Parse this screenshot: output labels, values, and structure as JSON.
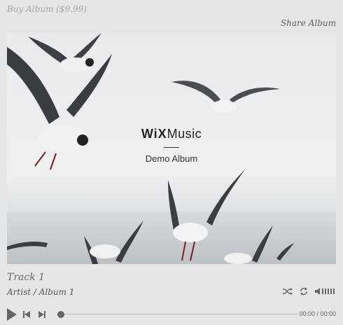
{
  "header": {
    "buy_label": "Buy Album ($9.99)",
    "share_label": "Share Album"
  },
  "cover": {
    "logo_bold": "WiX",
    "logo_rest": "Music",
    "album_title": "Demo Album"
  },
  "track": {
    "title": "Track 1",
    "artist_album": "Artist / Album 1"
  },
  "player": {
    "time": "00:00 / 00:00",
    "progress_fraction": 0
  },
  "icons": {
    "shuffle": "shuffle-icon",
    "repeat": "repeat-icon",
    "volume": "volume-icon",
    "play": "play-icon",
    "previous": "previous-icon",
    "next": "next-icon"
  },
  "colors": {
    "background": "#e6e6e6",
    "link_muted": "#a3a3a3",
    "text_dark": "#5e5e5e",
    "control": "#666666"
  }
}
